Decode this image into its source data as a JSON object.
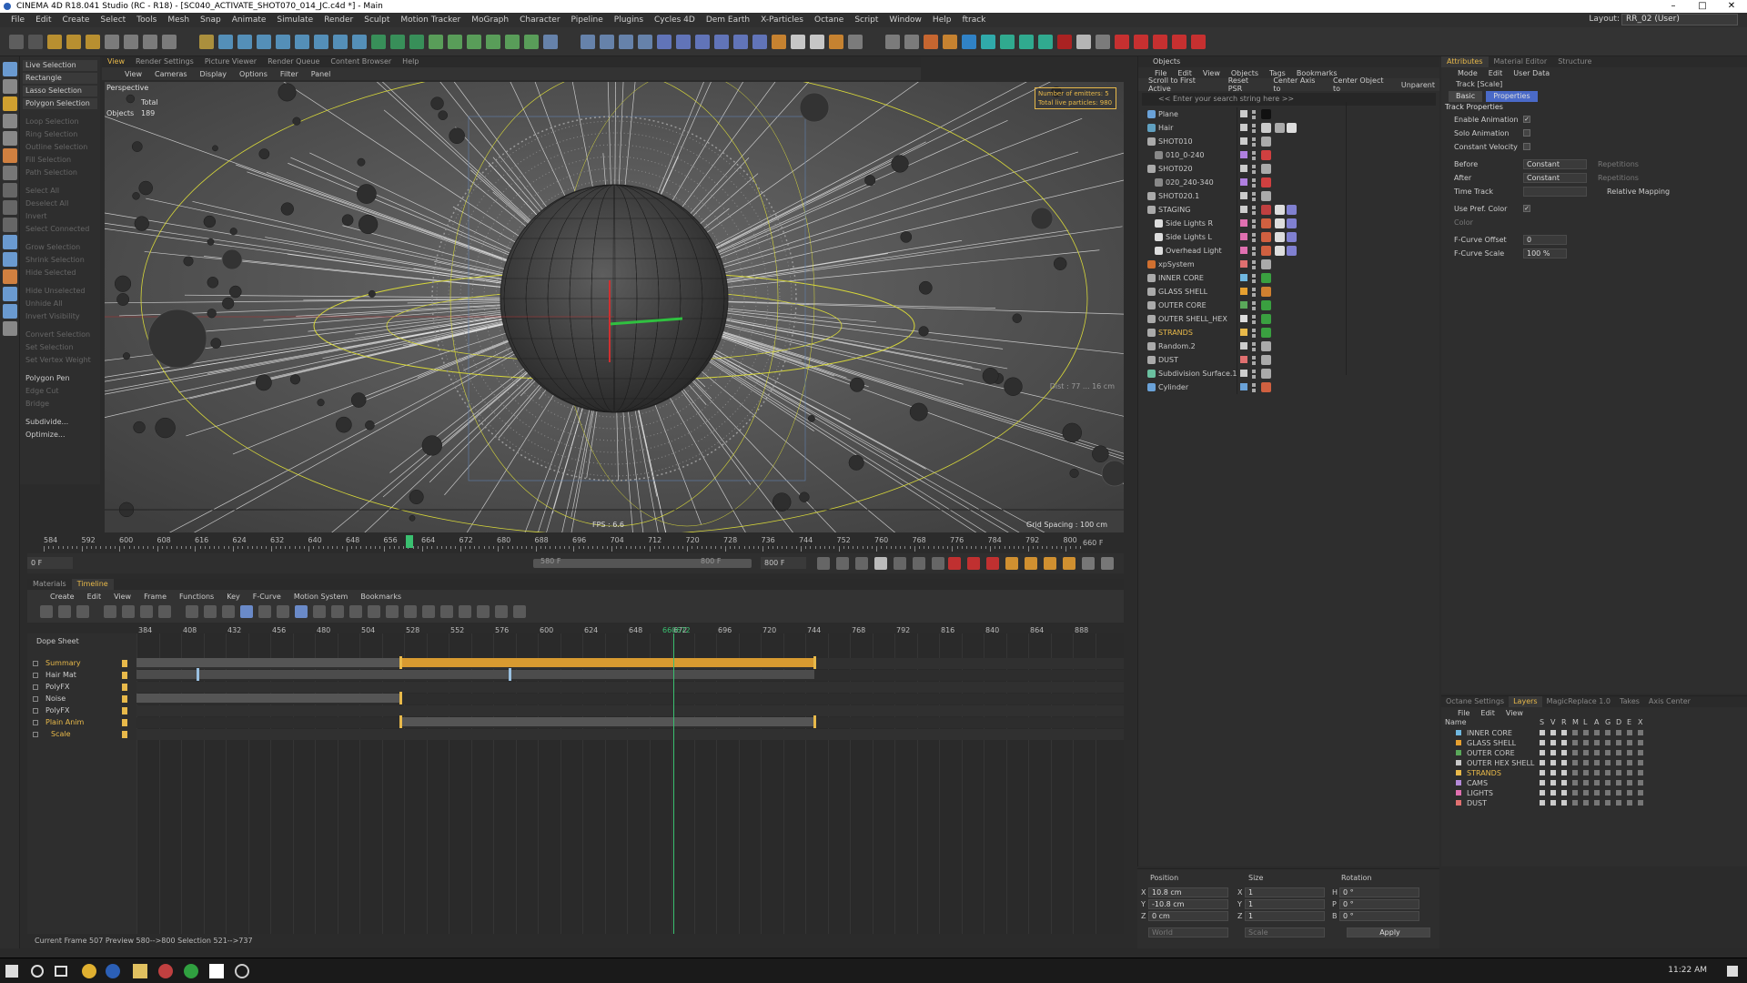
{
  "window": {
    "title": "CINEMA 4D R18.041 Studio (RC - R18) - [SC040_ACTIVATE_SHOT070_014_JC.c4d *] - Main",
    "minimize": "–",
    "maximize": "□",
    "close": "✕"
  },
  "menubar": {
    "items": [
      "File",
      "Edit",
      "Create",
      "Select",
      "Tools",
      "Mesh",
      "Snap",
      "Animate",
      "Simulate",
      "Render",
      "Sculpt",
      "Motion Tracker",
      "MoGraph",
      "Character",
      "Pipeline",
      "Plugins",
      "Cycles 4D",
      "Dem Earth",
      "X-Particles",
      "Octane",
      "Script",
      "Window",
      "Help",
      "ftrack"
    ],
    "layout_label": "Layout:",
    "layout_value": "RR_02 (User)"
  },
  "selection_panel": {
    "items": [
      "Live Selection",
      "Rectangle Selection",
      "Lasso Selection",
      "Polygon Selection",
      "Loop Selection",
      "Ring Selection",
      "Outline Selection",
      "Fill Selection",
      "Path Selection",
      "Select All",
      "Deselect All",
      "Invert",
      "Select Connected",
      "Grow Selection",
      "Shrink Selection",
      "Hide Selected",
      "Hide Unselected",
      "Unhide All",
      "Invert Visibility",
      "Convert Selection",
      "Set Selection",
      "Set Vertex Weight",
      "Polygon Pen",
      "Edge Cut",
      "Bridge",
      "Subdivide...",
      "Optimize..."
    ]
  },
  "viewport": {
    "tabs": [
      "View",
      "Render Settings",
      "Picture Viewer",
      "Render Queue",
      "Content Browser",
      "Help"
    ],
    "menu": [
      "View",
      "Cameras",
      "Display",
      "Options",
      "Filter",
      "Panel"
    ],
    "camera_label": "Perspective",
    "stats_total_label": "Total",
    "stats_objects_label": "Objects",
    "stats_objects_value": "189",
    "emitters_label": "Number of emitters: 5",
    "particles_label": "Total live particles: 980",
    "fps": "FPS : 6.6",
    "grid_spacing": "Grid Spacing : 100 cm",
    "dist": "Dist : 77 ... 16 cm"
  },
  "ruler": {
    "ticks": [
      "584",
      "592",
      "600",
      "608",
      "616",
      "624",
      "632",
      "640",
      "648",
      "656",
      "664",
      "672",
      "680",
      "688",
      "696",
      "704",
      "712",
      "720",
      "728",
      "736",
      "744",
      "752",
      "760",
      "768",
      "776",
      "784",
      "792",
      "800"
    ],
    "current_frame_label": "660 F"
  },
  "playback": {
    "start_frame": "0 F",
    "range_start": "580 F",
    "range_end": "800 F",
    "end_frame": "800 F"
  },
  "timeline": {
    "tabs": [
      "Materials",
      "Timeline"
    ],
    "menu": [
      "Create",
      "Edit",
      "View",
      "Frame",
      "Functions",
      "Key",
      "F-Curve",
      "Motion System",
      "Bookmarks"
    ],
    "mode_label": "Dope Sheet",
    "scale_ticks": [
      "384",
      "408",
      "432",
      "456",
      "480",
      "504",
      "528",
      "552",
      "576",
      "600",
      "624",
      "648",
      "672",
      "696",
      "720",
      "744",
      "768",
      "792",
      "816",
      "840",
      "864",
      "888"
    ],
    "marker_label": "660672",
    "tracks": [
      "Summary",
      "Hair Mat",
      "PolyFX",
      "Noise",
      "PolyFX",
      "Plain Anim",
      "Scale"
    ],
    "status": "Current Frame  507   Preview  580-->800   Selection  521-->737"
  },
  "objects_panel": {
    "title": "Objects",
    "menu": [
      "File",
      "Edit",
      "View",
      "Objects",
      "Tags",
      "Bookmarks"
    ],
    "buttons": [
      "Scroll to First Active",
      "Reset PSR",
      "Center Axis to",
      "Center Object to",
      "Unparent"
    ],
    "search_placeholder": "<< Enter your search string here >>",
    "items": [
      "Plane",
      "Hair",
      "SHOT010",
      "010_0-240",
      "SHOT020",
      "020_240-340",
      "SHOT020.1",
      "STAGING",
      "Side Lights R",
      "Side Lights L",
      "Overhead Light",
      "xpSystem",
      "INNER CORE",
      "GLASS SHELL",
      "OUTER CORE",
      "OUTER SHELL_HEX",
      "STRANDS",
      "Random.2",
      "DUST",
      "Subdivision Surface.1",
      "Cylinder"
    ]
  },
  "attributes_panel": {
    "tabs": [
      "Attributes",
      "Material Editor",
      "Structure"
    ],
    "menu": [
      "Mode",
      "Edit",
      "User Data"
    ],
    "track_label": "Track [Scale]",
    "subtabs": [
      "Basic",
      "Properties"
    ],
    "section": "Track Properties",
    "enable_animation": "Enable Animation",
    "solo_animation": "Solo Animation",
    "constant_velocity": "Constant Velocity",
    "before_label": "Before",
    "before_value": "Constant",
    "after_label": "After",
    "after_value": "Constant",
    "repetitions_label": "Repetitions",
    "time_track_label": "Time Track",
    "relative_mapping": "Relative Mapping",
    "use_pref_color": "Use Pref. Color",
    "color_label": "Color",
    "fcurve_offset_label": "F-Curve Offset",
    "fcurve_offset_value": "0",
    "fcurve_scale_label": "F-Curve Scale",
    "fcurve_scale_value": "100 %",
    "check": "✓"
  },
  "layers_panel": {
    "tabs": [
      "Octane Settings",
      "Layers",
      "MagicReplace 1.0",
      "Takes",
      "Axis Center"
    ],
    "menu": [
      "File",
      "Edit",
      "View"
    ],
    "name_header": "Name",
    "col_headers": [
      "S",
      "V",
      "R",
      "M",
      "L",
      "A",
      "G",
      "D",
      "E",
      "X"
    ],
    "layers": [
      "INNER CORE",
      "GLASS SHELL",
      "OUTER CORE",
      "OUTER HEX SHELL",
      "STRANDS",
      "CAMS",
      "LIGHTS",
      "DUST"
    ],
    "colors": [
      "#6fb7e0",
      "#e6a030",
      "#5aa85a",
      "#c8c8c8",
      "#e8b94a",
      "#b48ad8",
      "#e070b0",
      "#e07070"
    ]
  },
  "coordinates": {
    "position_label": "Position",
    "size_label": "Size",
    "rotation_label": "Rotation",
    "x_pos": "10.8 cm",
    "y_pos": "-10.8 cm",
    "z_pos": "0 cm",
    "x_size": "1",
    "y_size": "1",
    "z_size": "1",
    "h_rot": "0 °",
    "p_rot": "0 °",
    "b_rot": "0 °",
    "world": "World",
    "scale": "Scale",
    "apply": "Apply"
  },
  "taskbar": {
    "time": "11:22 AM"
  }
}
